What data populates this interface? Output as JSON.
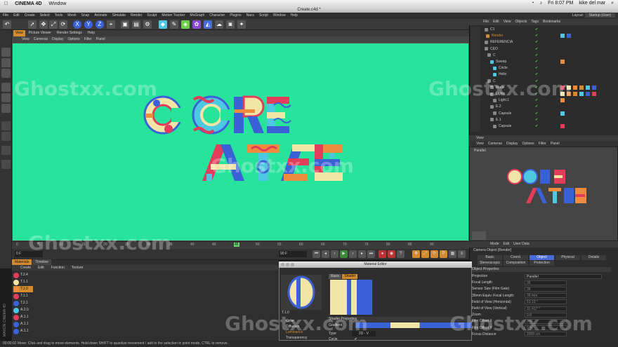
{
  "mac_menu": {
    "apple": "",
    "app": "CINEMA 4D",
    "window": "Window",
    "clock": "Fri 8:07 PM",
    "user": "kike del mar"
  },
  "window_title": "Create.c4d *",
  "menu": [
    "File",
    "Edit",
    "Create",
    "Select",
    "Tools",
    "Mesh",
    "Snap",
    "Animate",
    "Simulate",
    "Render",
    "Sculpt",
    "Motion Tracker",
    "MoGraph",
    "Character",
    "Plugins",
    "Nacs",
    "Script",
    "Window",
    "Help"
  ],
  "layout": {
    "label": "Layout:",
    "value": "Startup (User)"
  },
  "viewport": {
    "tabs": [
      "View",
      "Picture Viewer",
      "Render Settings",
      "Help"
    ],
    "menu": [
      "View",
      "Cameras",
      "Display",
      "Options",
      "Filter",
      "Panel"
    ],
    "bg_color": "#28e39c"
  },
  "timeline": {
    "ticks": [
      "0",
      "5",
      "10",
      "15",
      "20",
      "25",
      "30",
      "35",
      "40",
      "45",
      "46",
      "50",
      "55",
      "60",
      "65",
      "70",
      "75",
      "80",
      "85",
      "90"
    ],
    "current_frame": "0 F",
    "start": "0 F",
    "end": "90 F",
    "right_field": "90 F"
  },
  "materials": {
    "tabs": [
      "Materials",
      "Timeline"
    ],
    "menu": [
      "Create",
      "Edit",
      "Function",
      "Texture"
    ],
    "items": [
      {
        "name": "T.2.4",
        "color": "#e23d5b"
      },
      {
        "name": "T.1.1",
        "color": "#f3e5a6"
      },
      {
        "name": "T.1.0",
        "color": "#f08a3c"
      },
      {
        "name": "T.1.1",
        "color": "#e23d5b"
      },
      {
        "name": "T.2.1",
        "color": "#3a62d6"
      },
      {
        "name": "A.2.0",
        "color": "#4ec7e2"
      },
      {
        "name": "A.1.1",
        "color": "#e23d5b"
      },
      {
        "name": "A.1.1",
        "color": "#3a62d6"
      },
      {
        "name": "A.1.1",
        "color": "#3a62d6"
      }
    ],
    "brand": "MAXON CINEMA 4D"
  },
  "status": "00:00:02  Move: Click and drag to move elements. Hold down SHIFT to quantize movement / add to the selection in point mode, CTRL to remove.",
  "object_manager": {
    "menu": [
      "File",
      "Edit",
      "View",
      "Objects",
      "Tags",
      "Bookmarks"
    ],
    "rows": [
      {
        "name": "C1",
        "color": "#888"
      },
      {
        "name": "Render",
        "color": "#d48a2e"
      },
      {
        "name": "REFERENCIA",
        "color": "#888"
      },
      {
        "name": "CEO",
        "color": "#888"
      },
      {
        "name": "C",
        "color": "#888"
      },
      {
        "name": "Sweep",
        "color": "#4ec7e2"
      },
      {
        "name": "Circle",
        "color": "#4ec7e2"
      },
      {
        "name": "Helix",
        "color": "#4ec7e2"
      },
      {
        "name": "C",
        "color": "#888"
      },
      {
        "name": "Made",
        "color": "#888"
      },
      {
        "name": "Lights",
        "color": "#888"
      },
      {
        "name": "Light.1",
        "color": "#888"
      },
      {
        "name": "E.2",
        "color": "#888"
      },
      {
        "name": "Capsule",
        "color": "#888"
      },
      {
        "name": "E.1",
        "color": "#888"
      },
      {
        "name": "Capsule",
        "color": "#888"
      }
    ]
  },
  "view2": {
    "title": "View",
    "menu": [
      "View",
      "Cameras",
      "Display",
      "Options",
      "Filter",
      "Panel"
    ],
    "camera": "Parallel"
  },
  "attributes": {
    "menu": [
      "Mode",
      "Edit",
      "User Data"
    ],
    "title": "Camera Object [Render]",
    "tabs": [
      "Basic",
      "Coord.",
      "Object",
      "Physical",
      "Details",
      "Stereoscopic",
      "Composition",
      "Protection"
    ],
    "section": "Object Properties",
    "rows": [
      {
        "label": "Projection",
        "value": "Parallel"
      },
      {
        "label": "Focal Length",
        "value": "36"
      },
      {
        "label": "Sensor Size (Film Gate)",
        "value": "36"
      },
      {
        "label": "35mm Equiv. Focal Length:",
        "value": "36 mm"
      },
      {
        "label": "Field of View (Horizontal)",
        "value": "53.13 °"
      },
      {
        "label": "Field of View (Vertical)",
        "value": "31.417 °"
      },
      {
        "label": "Zoom",
        "value": "0.8"
      },
      {
        "label": "Film Offset X",
        "value": "0 %"
      },
      {
        "label": "Film Offset Y",
        "value": "0 %"
      },
      {
        "label": "Focus Distance",
        "value": "2000 cm"
      }
    ]
  },
  "material_editor": {
    "title": "Material Editor",
    "tabs": [
      "Basic",
      "Shader"
    ],
    "material_name": "T.1.0",
    "section": "Shader Properties",
    "gradient_label": "Gradient",
    "type_label": "Type",
    "type_value": "2D - V",
    "cycle_label": "Cycle",
    "channels": [
      "Color",
      "Diffusion",
      "Luminance",
      "Transparency"
    ]
  },
  "watermark": "Ghostxx.com"
}
